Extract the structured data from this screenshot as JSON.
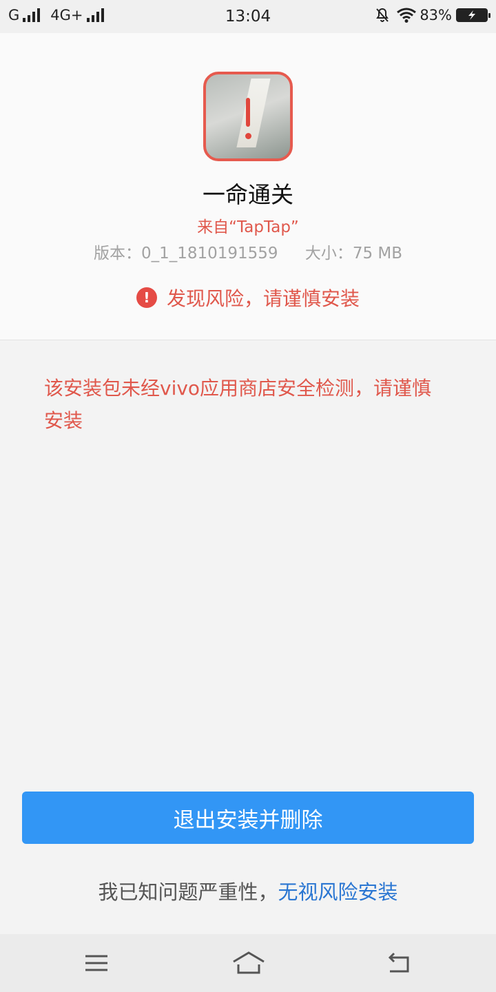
{
  "status_bar": {
    "carrier1": "G",
    "carrier2": "4G+",
    "time": "13:04",
    "battery": "83%"
  },
  "app": {
    "name": "一命通关",
    "source": "来自“TapTap”",
    "version": "版本：0_1_1810191559",
    "size": "大小：75 MB",
    "risk_label": "发现风险，请谨慎安装",
    "warning_message": "该安装包未经vivo应用商店安全检测，请谨慎安装"
  },
  "actions": {
    "exit_label": "退出安装并删除",
    "ignore_prefix": "我已知问题严重性，",
    "ignore_link": "无视风险安装"
  },
  "icons": {
    "warning": "!",
    "nav_menu": "menu-icon",
    "nav_home": "home-icon",
    "nav_back": "back-icon"
  },
  "colors": {
    "accent_red": "#e0584c",
    "primary_blue": "#3296f5",
    "link_blue": "#2a76d2"
  }
}
